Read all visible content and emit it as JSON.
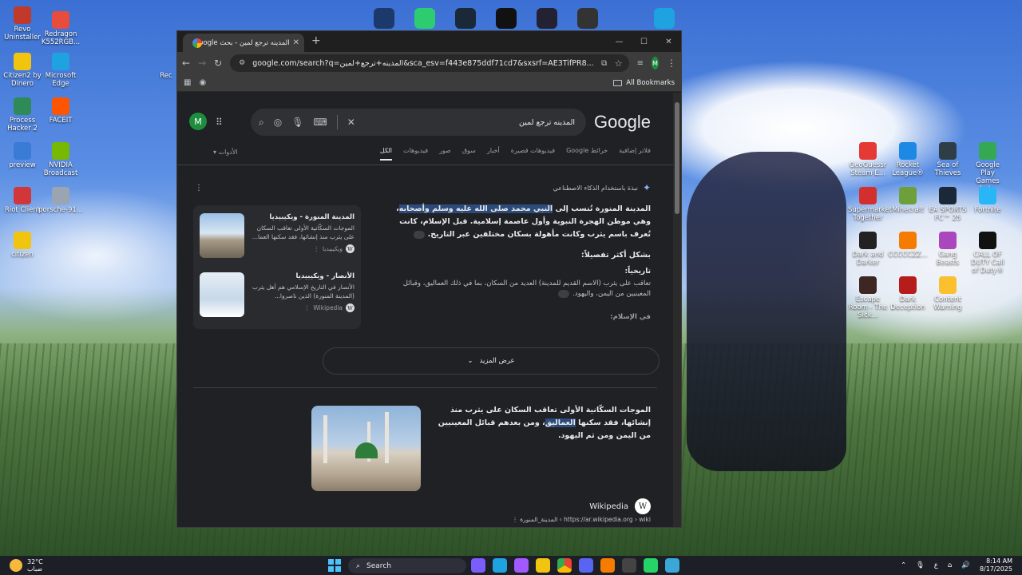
{
  "desktop": {
    "left_icons": [
      {
        "label": "Revo Uninstaller",
        "color": "#c0392b"
      },
      {
        "label": "Redragon K552RGB...",
        "color": "#e74c3c"
      },
      {
        "label": "Citizen2 by Dinero",
        "color": "#f1c40f"
      },
      {
        "label": "Microsoft Edge",
        "color": "#1fa3e0"
      },
      {
        "label": "Process Hacker 2",
        "color": "#2e8b57"
      },
      {
        "label": "FACEIT",
        "color": "#ff5500"
      },
      {
        "label": "preview",
        "color": "#3a7bd5"
      },
      {
        "label": "NVIDIA Broadcast",
        "color": "#76b900"
      },
      {
        "label": "Riot Client",
        "color": "#d13639"
      },
      {
        "label": "porsche-91...",
        "color": "#9aa5b1"
      },
      {
        "label": "citizen",
        "color": "#f1c40f"
      }
    ],
    "partial_label": "Rec",
    "right_icons": [
      {
        "label": "GeoGuessr Steam E...",
        "color": "#e53935"
      },
      {
        "label": "Rocket League®",
        "color": "#1e88e5"
      },
      {
        "label": "Sea of Thieves",
        "color": "#2f3e46"
      },
      {
        "label": "Google Play Games beta",
        "color": "#34a853"
      },
      {
        "label": "Supermarket Together",
        "color": "#d32f2f"
      },
      {
        "label": "Minecraft",
        "color": "#6d9f3a"
      },
      {
        "label": "EA SPORTS FC™ 25",
        "color": "#1b2838"
      },
      {
        "label": "Fortnite",
        "color": "#29b6f6"
      },
      {
        "label": "Dark and Darker",
        "color": "#222222"
      },
      {
        "label": "CCCCCZZ...",
        "color": "#f57c00"
      },
      {
        "label": "Gang Beasts",
        "color": "#ab47bc"
      },
      {
        "label": "CALL OF DUTY Call of Duty®",
        "color": "#111111"
      },
      {
        "label": "Escape Room - The Sick...",
        "color": "#3e2723"
      },
      {
        "label": "Dark Deception",
        "color": "#b71c1c"
      },
      {
        "label": "Content Warning",
        "color": "#fbc02d"
      }
    ]
  },
  "browser": {
    "tab_title": "المدينه ترجع لمين - بحث Google",
    "url": "google.com/search?q=المدينه+ترجع+لمين&sca_esv=f443e875ddf71cd7&sxsrf=AE3TifPR8...",
    "bookmarks_label": "All Bookmarks",
    "avatar_letter": "M"
  },
  "google": {
    "logo": "Google",
    "query": "المدينه ترجع لمين",
    "account_letter": "M",
    "tabs": [
      "الكل",
      "فيديوهات",
      "صور",
      "سوق",
      "أخبار",
      "فيديوهات قصيرة",
      "خرائط Google",
      "فلاتر إضافية"
    ],
    "tools": "الأدوات",
    "ai_header": "نبذة باستخدام الذكاء الاصطناعي",
    "ai_para_prefix": "المدينة المنورة تُنسب إلى ",
    "ai_para_highlight": "النبي محمد صلى الله عليه وسلم وأصحابه",
    "ai_para_suffix": "، وهي موطن الهجرة النبوية وأول عاصمة إسلامية. قبل الإسلام، كانت تُعرف باسم يثرب وكانت مأهولة بسكان مختلفين عبر التاريخ.",
    "ai_more_detail": "بشكل أكثر تفصيلاً:",
    "ai_history": "تاريخياً:",
    "ai_history_text": "تعاقب على يثرب (الاسم القديم للمدينة) العديد من السكان، بما في ذلك العماليق، وقبائل المعينيين من اليمن، واليهود.",
    "ai_islam": "في الإسلام:",
    "sources": [
      {
        "title": "المدينة المنورة - ويكيبيديا",
        "desc": "الموجات السكّانية الأولى تعاقب السكان على يثرب منذ إنشائها، فقد سكنها العما...",
        "site": "ويكيبيديا"
      },
      {
        "title": "الأنصار - ويكيبيديا",
        "desc": "الأنصار في التاريخ الإسلامي هم أهل يثرب (المدينة المنورة) الذين ناصروا...",
        "site": "Wikipedia"
      }
    ],
    "show_more": "عرض المزيد",
    "featured_prefix": "الموجات السكّانية الأولى تعاقب السكان على يثرب منذ إنشائها، فقد سكنها ",
    "featured_highlight": "العماليق",
    "featured_suffix": "، ومن بعدهم قبائل المعينيين من اليمن ومن ثم اليهود.",
    "result_site": "Wikipedia",
    "result_url": "https://ar.wikipedia.org › wiki › المدينة_المنورة"
  },
  "taskbar": {
    "temp": "32°C",
    "weather": "ضباب",
    "search": "Search",
    "time": "8:14 AM",
    "date": "8/17/2025",
    "lang": "ع"
  }
}
